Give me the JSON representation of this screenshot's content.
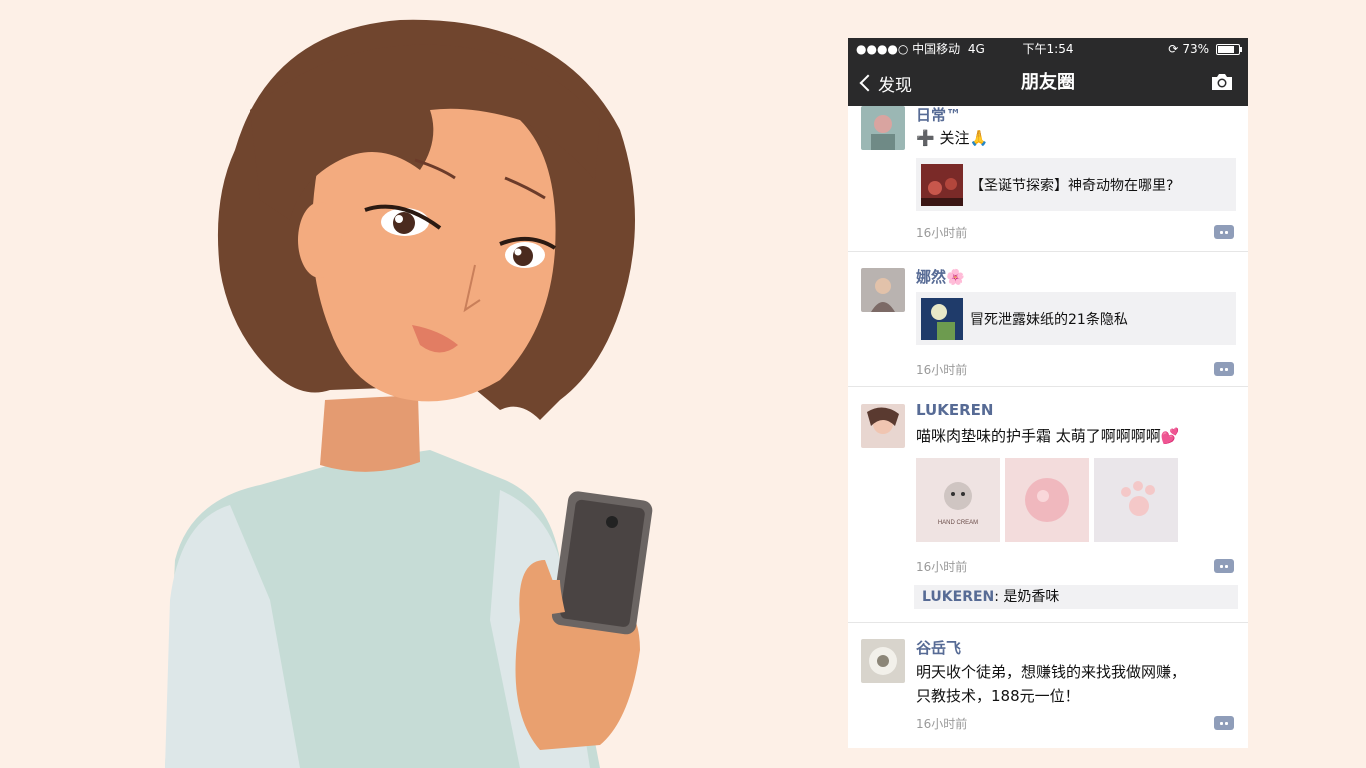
{
  "status_bar": {
    "carrier": "●●●●○ 中国移动",
    "network": "4G",
    "time": "下午1:54",
    "battery": "73%",
    "battery_level": 0.73
  },
  "nav": {
    "back_label": "发现",
    "title": "朋友圈"
  },
  "posts": [
    {
      "name": "日常™",
      "text": "➕ 关注🙏",
      "link_title": "【圣诞节探索】神奇动物在哪里?",
      "time": "16小时前"
    },
    {
      "name": "娜然🌸",
      "link_title": "冒死泄露妹纸的21条隐私",
      "time": "16小时前"
    },
    {
      "name": "LUKEREN",
      "text": "喵咪肉垫味的护手霜 太萌了啊啊啊啊💕",
      "photo_label": "PUNI PUNI NIKUQYU HAND CREAM",
      "time": "16小时前",
      "comment_user": "LUKEREN",
      "comment_text": ": 是奶香味"
    },
    {
      "name": "谷岳飞",
      "text_line1": "明天收个徒弟，想赚钱的来找我做网赚，",
      "text_line2": "只教技术，188元一位！",
      "time": "16小时前"
    }
  ],
  "colors": {
    "background": "#fdf0e7",
    "nav_bg": "#2a2a2b",
    "name_blue": "#576b95",
    "skin": "#f3ab7f",
    "hair": "#70452e",
    "sweater": "#c6dcd6"
  }
}
